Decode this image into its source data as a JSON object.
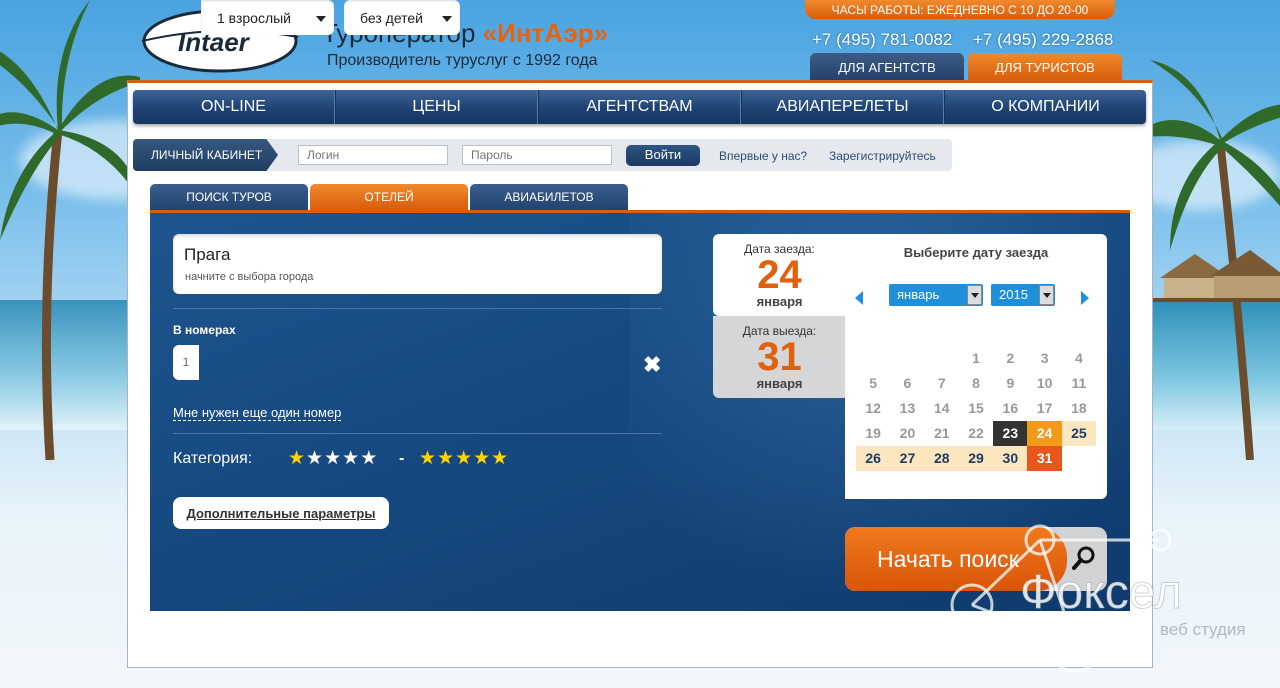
{
  "header": {
    "logo_text": "Intaer",
    "brand_prefix": "Туроператор ",
    "brand_name": "«ИнтАэр»",
    "slogan": "Производитель туруслуг с 1992 года",
    "hours": "ЧАСЫ РАБОТЫ: ЕЖЕДНЕВНО С 10 ДО 20-00",
    "phone1": "+7 (495) 781-0082",
    "phone2": "+7 (495) 229-2868",
    "tab_agents": "ДЛЯ АГЕНТСТВ",
    "tab_tourists": "ДЛЯ ТУРИСТОВ"
  },
  "nav": [
    "ON-LINE",
    "ЦЕНЫ",
    "АГЕНТСТВАМ",
    "АВИАПЕРЕЛЕТЫ",
    "О КОМПАНИИ"
  ],
  "login": {
    "label": "ЛИЧНЫЙ КАБИНЕТ",
    "login_placeholder": "Логин",
    "password_placeholder": "Пароль",
    "button": "Войти",
    "first_time": "Впервые у нас?",
    "register": "Зарегистрируйтесь"
  },
  "search_tabs": [
    "ПОИСК ТУРОВ",
    "ОТЕЛЕЙ",
    "АВИАБИЛЕТОВ"
  ],
  "form": {
    "city_value": "Прага",
    "city_hint": "начните с выбора города",
    "rooms_label": "В номерах",
    "room_number": "1",
    "adults": "1 взрослый",
    "children": "без детей",
    "remove_icon": "✖",
    "add_room_link": "Мне нужен еще один номер",
    "category_label": "Категория:",
    "stars_from": "★★★★★",
    "dash": "-",
    "stars_to": "★★★★★",
    "extra_params": "Дополнительные параметры"
  },
  "dates": {
    "checkin_label": "Дата заезда:",
    "checkin_day": "24",
    "checkin_month": "января",
    "checkout_label": "Дата выезда:",
    "checkout_day": "31",
    "checkout_month": "января"
  },
  "calendar": {
    "title": "Выберите дату заезда",
    "month": "январь",
    "year": "2015",
    "days": [
      "",
      "",
      "",
      "1",
      "2",
      "3",
      "4",
      "5",
      "6",
      "7",
      "8",
      "9",
      "10",
      "11",
      "12",
      "13",
      "14",
      "15",
      "16",
      "17",
      "18",
      "19",
      "20",
      "21",
      "22",
      "23",
      "24",
      "25",
      "26",
      "27",
      "28",
      "29",
      "30",
      "31",
      ""
    ],
    "state": [
      "",
      "",
      "",
      "",
      "",
      "",
      "",
      "",
      "",
      "",
      "",
      "",
      "",
      "",
      "",
      "",
      "",
      "",
      "",
      "",
      "",
      "",
      "",
      "",
      "",
      "today",
      "in",
      "sel-r",
      "sel-r",
      "sel-r",
      "sel-r",
      "sel-r",
      "sel-r",
      "out",
      ""
    ]
  },
  "search_button": "Начать поиск",
  "watermark": {
    "name": "Фоксел",
    "sub": "веб студия"
  },
  "colors": {
    "orange": "#e8630f",
    "navy": "#1d4273",
    "accent_blue": "#1e8fd8"
  }
}
